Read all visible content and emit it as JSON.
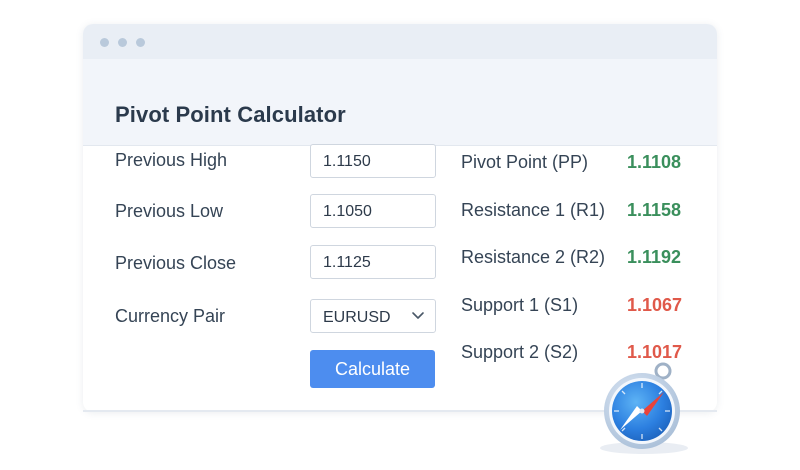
{
  "window": {
    "title": "Pivot Point Calculator"
  },
  "form": {
    "fields": [
      {
        "label": "Previous High",
        "value": "1.1150"
      },
      {
        "label": "Previous Low",
        "value": "1.1050"
      },
      {
        "label": "Previous Close",
        "value": "1.1125"
      }
    ],
    "currency_pair": {
      "label": "Currency Pair",
      "selected": "EURUSD"
    },
    "calculate_label": "Calculate"
  },
  "results": [
    {
      "label": "Pivot Point (PP)",
      "value": "1.1108",
      "trend": "up"
    },
    {
      "label": "Resistance 1 (R1)",
      "value": "1.1158",
      "trend": "up"
    },
    {
      "label": "Resistance 2 (R2)",
      "value": "1.1192",
      "trend": "up"
    },
    {
      "label": "Support 1 (S1)",
      "value": "1.1067",
      "trend": "down"
    },
    {
      "label": "Support 2 (S2)",
      "value": "1.1017",
      "trend": "down"
    }
  ],
  "colors": {
    "accent": "#4d8def",
    "positive": "#3a8f5c",
    "negative": "#e0594a"
  },
  "icons": {
    "chevron": "chevron-down-icon",
    "compass": "compass-icon"
  }
}
